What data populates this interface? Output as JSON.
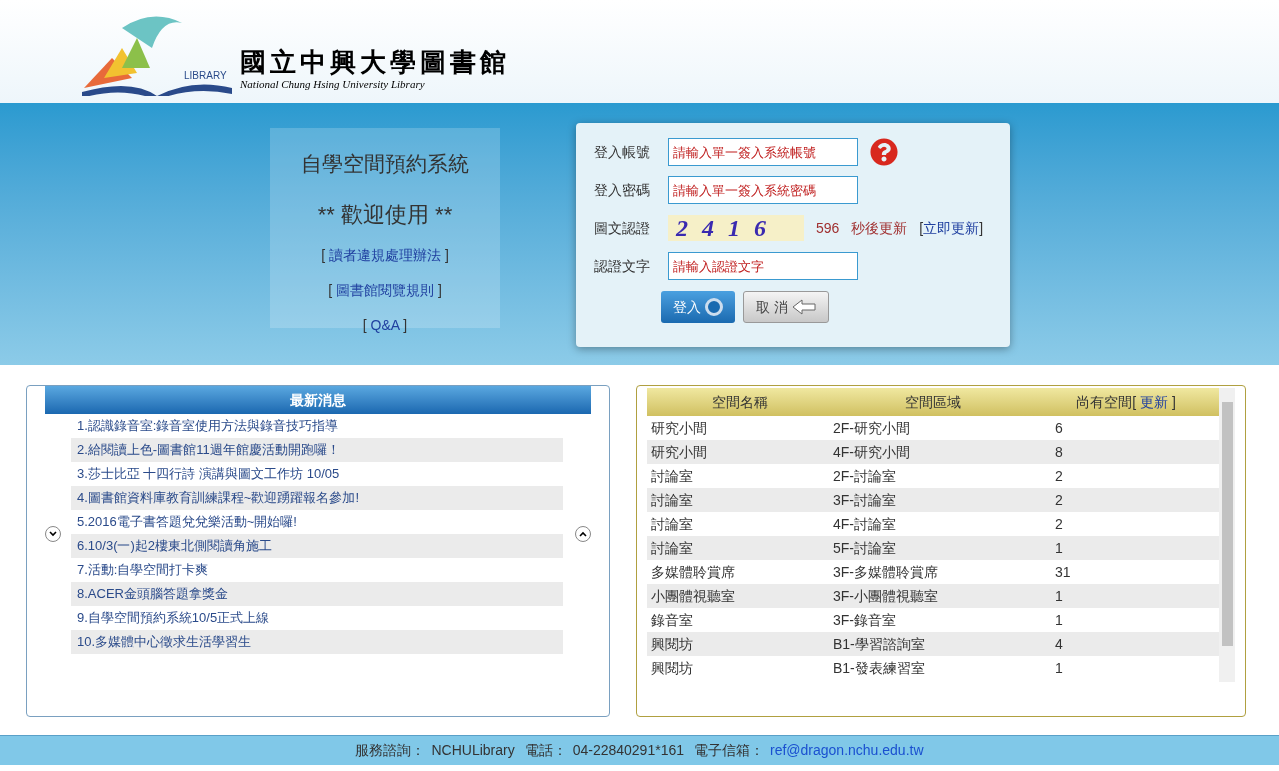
{
  "header": {
    "logo_badge": "LIBRARY",
    "logo_title": "國立中興大學圖書館",
    "logo_subtitle": "National Chung Hsing University Library"
  },
  "intro": {
    "title": "自學空間預約系統",
    "welcome": "** 歡迎使用 **",
    "links": [
      {
        "before": "[",
        "label": "讀者違規處理辦法",
        "after": "]"
      },
      {
        "before": "[",
        "label": "圖書館閱覽規則",
        "after": "]"
      },
      {
        "before": "[",
        "label": "Q&A",
        "after": "]"
      }
    ]
  },
  "login": {
    "fields": [
      {
        "kind": "account",
        "label": "登入帳號",
        "placeholder": "請輸入單一簽入系統帳號"
      },
      {
        "kind": "password",
        "label": "登入密碼",
        "placeholder": "請輸入單一簽入系統密碼"
      },
      {
        "kind": "captcha",
        "label": "圖文認證",
        "captcha": "2416",
        "countdown": "596",
        "countdown_suffix": "秒後更新",
        "refresh_before": "[",
        "refresh": "立即更新",
        "refresh_after": "]"
      },
      {
        "kind": "text",
        "label": "認證文字",
        "placeholder": "請輸入認證文字"
      }
    ],
    "buttons": [
      {
        "kind": "primary",
        "label": "登入"
      },
      {
        "kind": "secondary",
        "label": "取 消"
      }
    ]
  },
  "news": {
    "title": "最新消息",
    "items": [
      "1.認識錄音室:錄音室使用方法與錄音技巧指導",
      "2.給閱讀上色-圖書館11週年館慶活動開跑囉！",
      "3.莎士比亞 十四行詩 演講與圖文工作坊 10/05",
      "4.圖書館資料庫教育訓練課程~歡迎踴躍報名參加!",
      "5.2016電子書答題兌兌樂活動~開始囉!",
      "6.10/3(一)起2樓東北側閱讀角施工",
      "7.活動:自學空間打卡爽",
      "8.ACER金頭腦答題拿獎金",
      "9.自學空間預約系統10/5正式上線",
      "10.多媒體中心徵求生活學習生"
    ]
  },
  "spaces": {
    "columns": [
      "空間名稱",
      "空間區域",
      "尚有空間["
    ],
    "refresh": "更新",
    "refresh_after": "]",
    "rows": [
      [
        "研究小間",
        "2F-研究小間",
        "6"
      ],
      [
        "研究小間",
        "4F-研究小間",
        "8"
      ],
      [
        "討論室",
        "2F-討論室",
        "2"
      ],
      [
        "討論室",
        "3F-討論室",
        "2"
      ],
      [
        "討論室",
        "4F-討論室",
        "2"
      ],
      [
        "討論室",
        "5F-討論室",
        "1"
      ],
      [
        "多媒體聆賞席",
        "3F-多媒體聆賞席",
        "31"
      ],
      [
        "小團體視聽室",
        "3F-小團體視聽室",
        "1"
      ],
      [
        "錄音室",
        "3F-錄音室",
        "1"
      ],
      [
        "興閱坊",
        "B1-學習諮詢室",
        "4"
      ],
      [
        "興閱坊",
        "B1-發表練習室",
        "1"
      ]
    ]
  },
  "footer": [
    {
      "label": "服務諮詢：",
      "value": "NCHULibrary",
      "kind": "text"
    },
    {
      "label": "電話：",
      "value": "04-22840291*161",
      "kind": "text"
    },
    {
      "label": "電子信箱：",
      "value": "ref@dragon.nchu.edu.tw",
      "kind": "link"
    }
  ]
}
